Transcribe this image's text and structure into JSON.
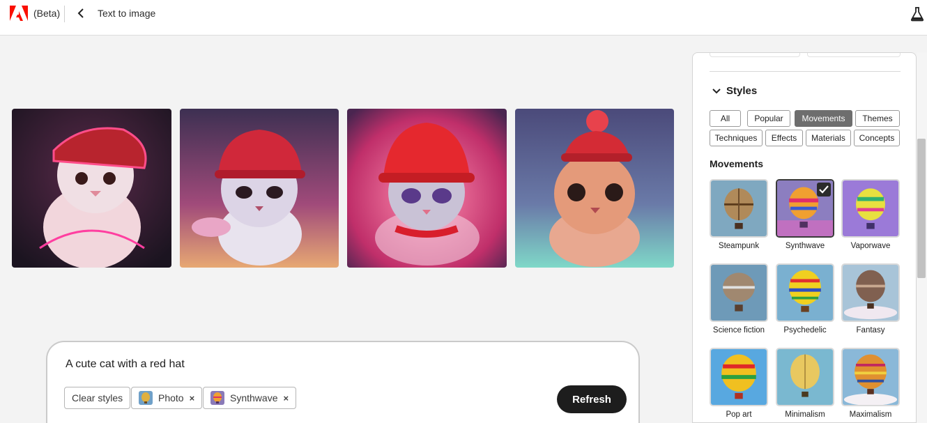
{
  "header": {
    "beta_label": "(Beta)",
    "title": "Text to image",
    "logo_icon": "adobe-logo-icon",
    "back_icon": "chevron-left-icon",
    "labs_icon": "flask-icon",
    "logo_color": "#fa0f00"
  },
  "gallery": {
    "images": [
      {
        "alt": "cat-image-1"
      },
      {
        "alt": "cat-image-2"
      },
      {
        "alt": "cat-image-3"
      },
      {
        "alt": "cat-image-4"
      }
    ]
  },
  "prompt": {
    "text": "A cute cat with a red hat",
    "clear_styles_label": "Clear styles",
    "chips": [
      {
        "label": "Photo",
        "remove": "×"
      },
      {
        "label": "Synthwave",
        "remove": "×"
      }
    ],
    "refresh_label": "Refresh"
  },
  "styles_panel": {
    "heading": "Styles",
    "tags": [
      {
        "label": "All",
        "active": false
      },
      {
        "label": "Popular",
        "active": false
      },
      {
        "label": "Movements",
        "active": true
      },
      {
        "label": "Themes",
        "active": false
      },
      {
        "label": "Techniques",
        "active": false
      },
      {
        "label": "Effects",
        "active": false
      },
      {
        "label": "Materials",
        "active": false
      },
      {
        "label": "Concepts",
        "active": false
      }
    ],
    "section_title": "Movements",
    "tiles": [
      {
        "label": "Steampunk",
        "selected": false
      },
      {
        "label": "Synthwave",
        "selected": true
      },
      {
        "label": "Vaporwave",
        "selected": false
      },
      {
        "label": "Science fiction",
        "selected": false
      },
      {
        "label": "Psychedelic",
        "selected": false
      },
      {
        "label": "Fantasy",
        "selected": false
      },
      {
        "label": "Pop art",
        "selected": false
      },
      {
        "label": "Minimalism",
        "selected": false
      },
      {
        "label": "Maximalism",
        "selected": false
      }
    ]
  }
}
